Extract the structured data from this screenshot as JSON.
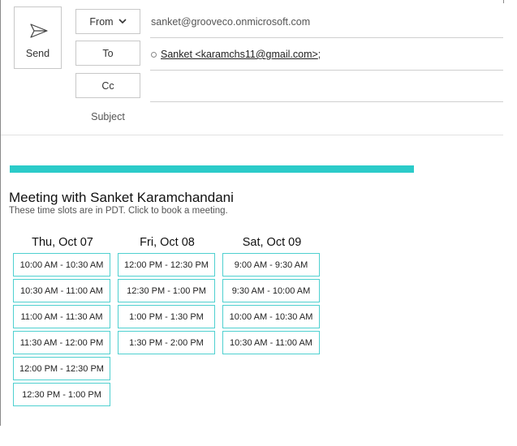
{
  "compose": {
    "send_label": "Send",
    "from_label": "From",
    "from_value": "sanket@grooveco.onmicrosoft.com",
    "to_label": "To",
    "to_recipient": "Sanket <karamchs11@gmail.com>",
    "to_separator": ";",
    "cc_label": "Cc",
    "subject_label": "Subject"
  },
  "colors": {
    "accent": "#2bcbc9",
    "slot_border": "#4fd0d0"
  },
  "meeting": {
    "title": "Meeting with Sanket Karamchandani",
    "subtitle": "These time slots are in PDT. Click to book a meeting.",
    "days": [
      {
        "label": "Thu, Oct 07",
        "slots": [
          "10:00 AM - 10:30 AM",
          "10:30 AM - 11:00 AM",
          "11:00 AM - 11:30 AM",
          "11:30 AM - 12:00 PM",
          "12:00 PM - 12:30 PM",
          "12:30 PM - 1:00 PM"
        ]
      },
      {
        "label": "Fri, Oct 08",
        "slots": [
          "12:00 PM - 12:30 PM",
          "12:30 PM - 1:00 PM",
          "1:00 PM - 1:30 PM",
          "1:30 PM - 2:00 PM"
        ]
      },
      {
        "label": "Sat, Oct 09",
        "slots": [
          "9:00 AM - 9:30 AM",
          "9:30 AM - 10:00 AM",
          "10:00 AM - 10:30 AM",
          "10:30 AM - 11:00 AM"
        ]
      }
    ]
  }
}
